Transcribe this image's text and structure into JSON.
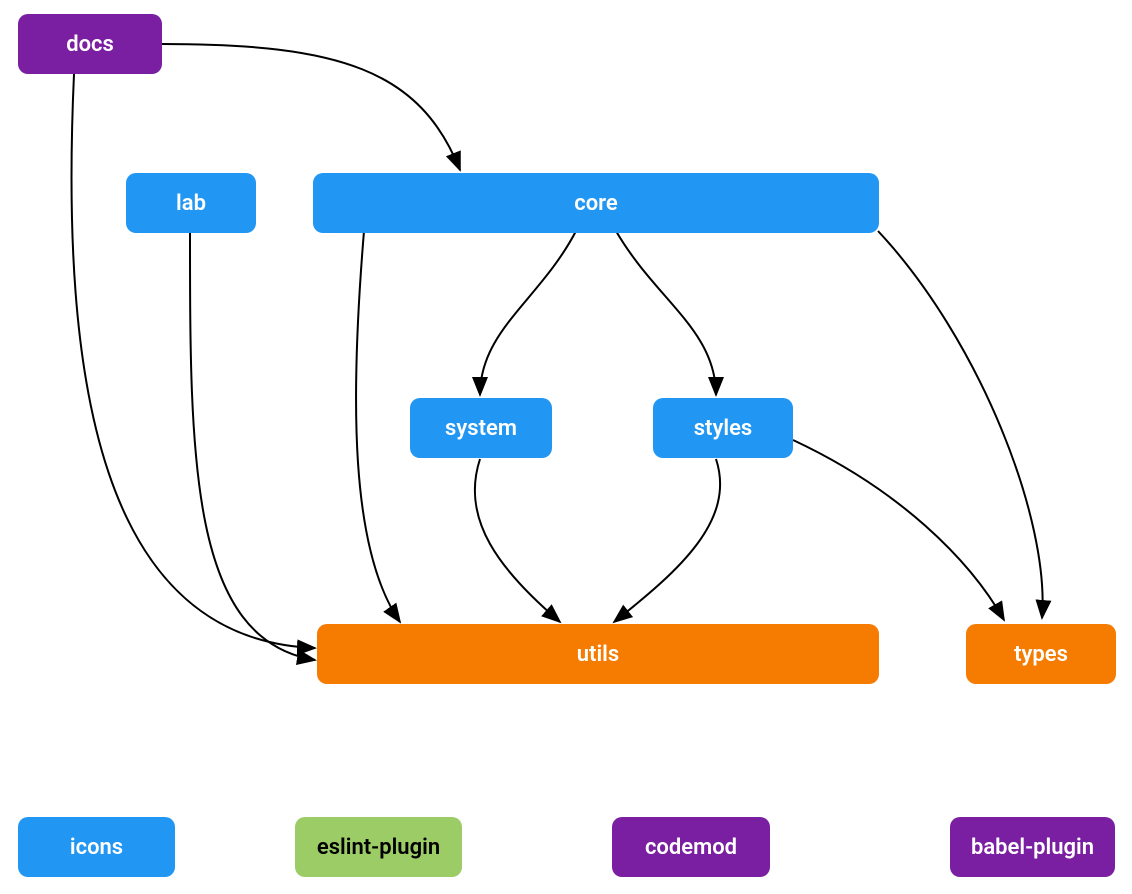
{
  "nodes": {
    "docs": {
      "label": "docs",
      "color": "purple"
    },
    "lab": {
      "label": "lab",
      "color": "blue"
    },
    "core": {
      "label": "core",
      "color": "blue"
    },
    "system": {
      "label": "system",
      "color": "blue"
    },
    "styles": {
      "label": "styles",
      "color": "blue"
    },
    "utils": {
      "label": "utils",
      "color": "orange"
    },
    "types": {
      "label": "types",
      "color": "orange"
    },
    "icons": {
      "label": "icons",
      "color": "blue"
    },
    "eslint_plugin": {
      "label": "eslint-plugin",
      "color": "green"
    },
    "codemod": {
      "label": "codemod",
      "color": "purple"
    },
    "babel_plugin": {
      "label": "babel-plugin",
      "color": "purple"
    }
  },
  "edges": [
    [
      "docs",
      "core"
    ],
    [
      "docs",
      "utils"
    ],
    [
      "lab",
      "utils"
    ],
    [
      "core",
      "system"
    ],
    [
      "core",
      "styles"
    ],
    [
      "core",
      "utils"
    ],
    [
      "core",
      "types"
    ],
    [
      "system",
      "utils"
    ],
    [
      "styles",
      "utils"
    ],
    [
      "styles",
      "types"
    ]
  ],
  "colors": {
    "purple": "#7b1fa2",
    "blue": "#2196f3",
    "orange": "#f57c00",
    "green": "#9ccc65"
  }
}
